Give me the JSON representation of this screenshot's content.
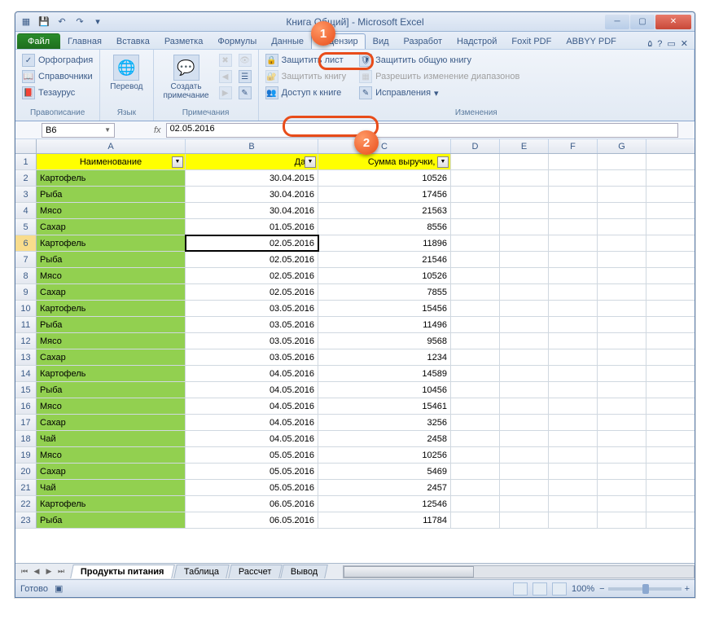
{
  "title": "Книга        Общий]  -  Microsoft Excel",
  "tabs": {
    "file": "Файл",
    "items": [
      "Главная",
      "Вставка",
      "Разметка",
      "Формулы",
      "Данные",
      "Рецензир",
      "Вид",
      "Разработ",
      "Надстрой",
      "Foxit PDF",
      "ABBYY PDF"
    ],
    "active_index": 5
  },
  "ribbon": {
    "g1": {
      "label": "Правописание",
      "spelling": "Орфография",
      "reference": "Справочники",
      "thesaurus": "Тезаурус"
    },
    "g2": {
      "label": "Язык",
      "translate": "Перевод"
    },
    "g3": {
      "label": "Примечания",
      "new_comment": "Создать\nпримечание"
    },
    "g4": {
      "label": "Изменения",
      "protect_sheet": "Защитить лист",
      "protect_book": "Защитить книгу",
      "share_book": "Доступ к книге",
      "protect_shared": "Защитить общую книгу",
      "allow_ranges": "Разрешить изменение диапазонов",
      "track": "Исправления"
    }
  },
  "namebox": "B6",
  "formula": "02.05.2016",
  "col_headers": [
    "A",
    "B",
    "C",
    "D",
    "E",
    "F",
    "G"
  ],
  "table_headers": [
    "Наименование",
    "Дата",
    "Сумма выручки, ру"
  ],
  "rows": [
    [
      "Картофель",
      "30.04.2015",
      "10526"
    ],
    [
      "Рыба",
      "30.04.2016",
      "17456"
    ],
    [
      "Мясо",
      "30.04.2016",
      "21563"
    ],
    [
      "Сахар",
      "01.05.2016",
      "8556"
    ],
    [
      "Картофель",
      "02.05.2016",
      "11896"
    ],
    [
      "Рыба",
      "02.05.2016",
      "21546"
    ],
    [
      "Мясо",
      "02.05.2016",
      "10526"
    ],
    [
      "Сахар",
      "02.05.2016",
      "7855"
    ],
    [
      "Картофель",
      "03.05.2016",
      "15456"
    ],
    [
      "Рыба",
      "03.05.2016",
      "11496"
    ],
    [
      "Мясо",
      "03.05.2016",
      "9568"
    ],
    [
      "Сахар",
      "03.05.2016",
      "1234"
    ],
    [
      "Картофель",
      "04.05.2016",
      "14589"
    ],
    [
      "Рыба",
      "04.05.2016",
      "10456"
    ],
    [
      "Мясо",
      "04.05.2016",
      "15461"
    ],
    [
      "Сахар",
      "04.05.2016",
      "3256"
    ],
    [
      "Чай",
      "04.05.2016",
      "2458"
    ],
    [
      "Мясо",
      "05.05.2016",
      "10256"
    ],
    [
      "Сахар",
      "05.05.2016",
      "5469"
    ],
    [
      "Чай",
      "05.05.2016",
      "2457"
    ],
    [
      "Картофель",
      "06.05.2016",
      "12546"
    ],
    [
      "Рыба",
      "06.05.2016",
      "11784"
    ]
  ],
  "selected_row": 6,
  "sheets": [
    "Продукты питания",
    "Таблица",
    "Рассчет",
    "Вывод"
  ],
  "active_sheet": 0,
  "status": "Готово",
  "zoom": "100%",
  "callouts": {
    "c1": "1",
    "c2": "2"
  }
}
